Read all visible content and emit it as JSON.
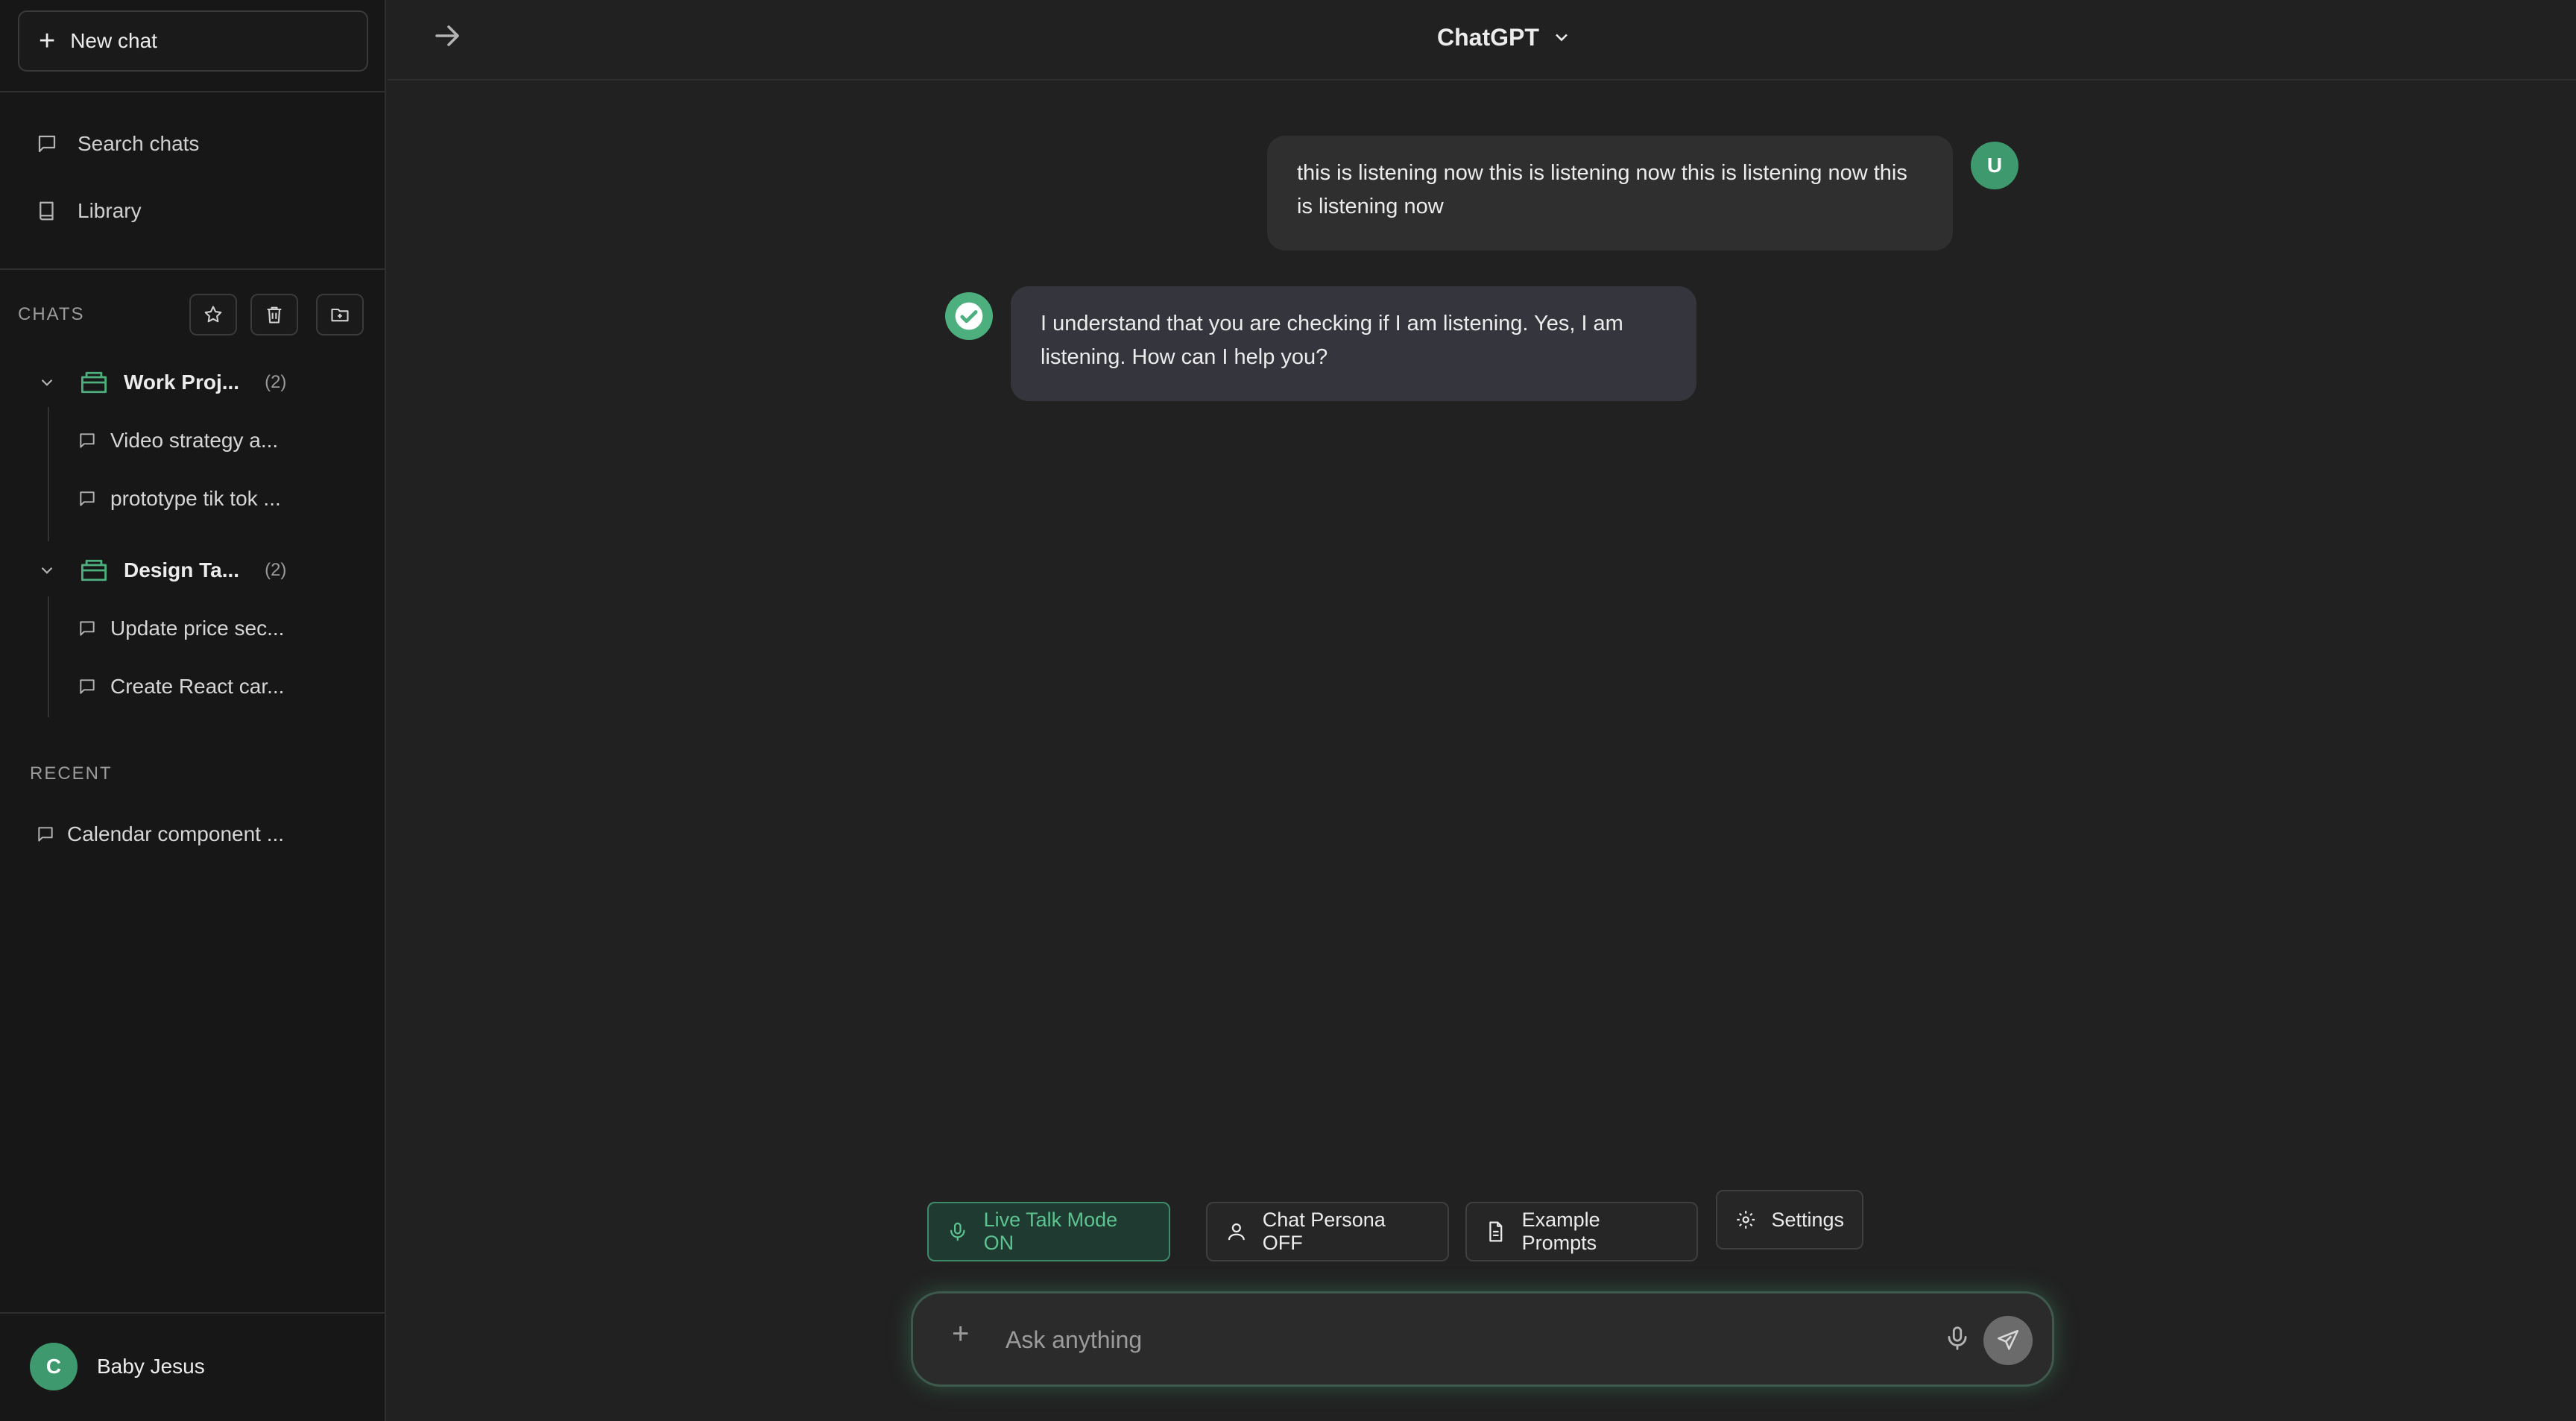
{
  "sidebar": {
    "new_chat_label": "New chat",
    "nav": [
      {
        "label": "Search chats",
        "icon": "message-icon"
      },
      {
        "label": "Library",
        "icon": "book-icon"
      }
    ],
    "chats_label": "CHATS",
    "folders": [
      {
        "name": "Work Proj...",
        "count": "(2)",
        "items": [
          "Video strategy a...",
          "prototype tik tok ..."
        ]
      },
      {
        "name": "Design Ta...",
        "count": "(2)",
        "items": [
          "Update price sec...",
          "Create React car..."
        ]
      }
    ],
    "recent_label": "RECENT",
    "recent": [
      "Calendar component ..."
    ],
    "user": {
      "initial": "C",
      "name": "Baby Jesus"
    }
  },
  "header": {
    "model": "ChatGPT"
  },
  "messages": [
    {
      "role": "user",
      "avatar": "U",
      "text": "this is listening now this is listening now this is listening now this is listening now"
    },
    {
      "role": "assistant",
      "text": "I understand that you are checking if I am listening. Yes, I am listening. How can I help you?"
    }
  ],
  "actions": {
    "live_talk": "Live Talk Mode ON",
    "persona": "Chat Persona OFF",
    "prompts": "Example Prompts",
    "settings": "Settings"
  },
  "composer": {
    "placeholder": "Ask anything"
  },
  "colors": {
    "accent": "#4caf7d",
    "background": "#212121",
    "sidebar": "#171717"
  }
}
